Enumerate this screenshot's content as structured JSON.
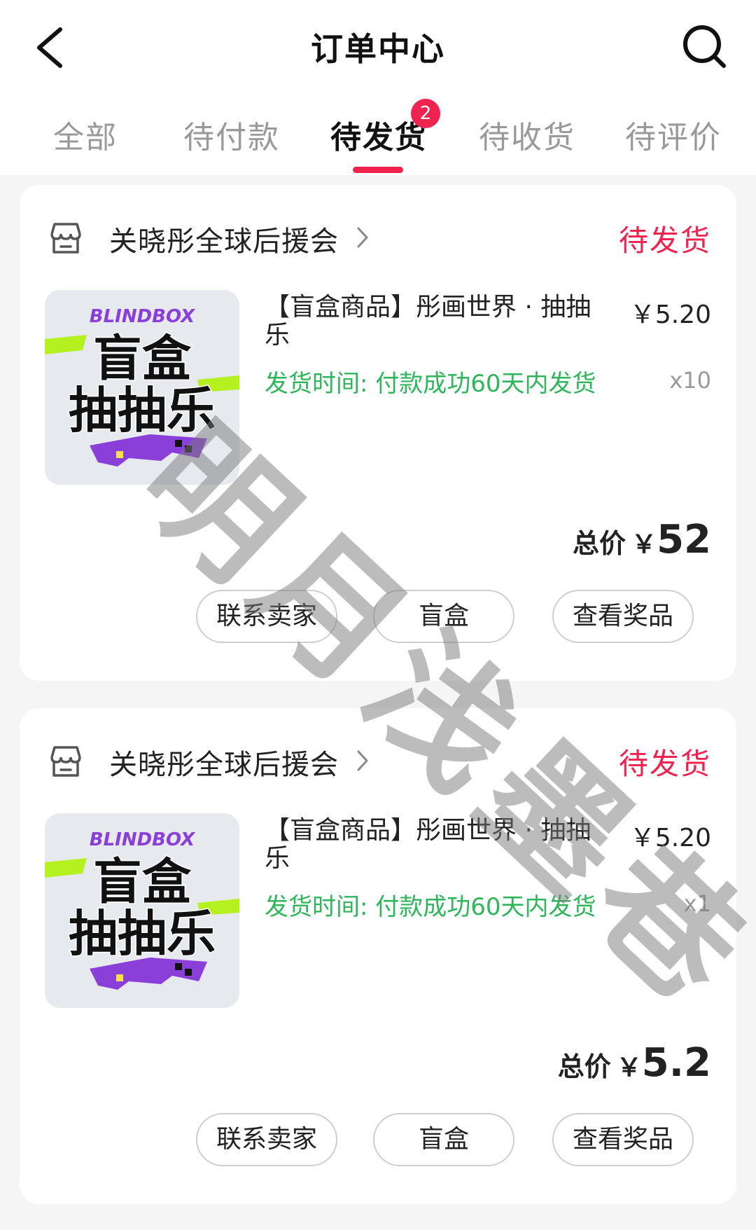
{
  "header": {
    "title": "订单中心"
  },
  "tabs": [
    {
      "label": "全部"
    },
    {
      "label": "待付款"
    },
    {
      "label": "待发货",
      "badge": "2"
    },
    {
      "label": "待收货"
    },
    {
      "label": "待评价"
    }
  ],
  "orders": [
    {
      "shop": "关晓彤全球后援会",
      "status": "待发货",
      "thumb": {
        "brand": "BLINDBOX",
        "line1": "盲盒",
        "line2": "抽抽乐"
      },
      "product_title": "【盲盒商品】彤画世界 · 抽抽乐",
      "price": "￥5.20",
      "ship_time": "发货时间: 付款成功60天内发货",
      "qty": "x10",
      "total_label": "总价",
      "total_currency": "￥",
      "total_value": "52",
      "buttons": {
        "contact": "联系卖家",
        "blindbox": "盲盒",
        "prize": "查看奖品"
      }
    },
    {
      "shop": "关晓彤全球后援会",
      "status": "待发货",
      "thumb": {
        "brand": "BLINDBOX",
        "line1": "盲盒",
        "line2": "抽抽乐"
      },
      "product_title": "【盲盒商品】彤画世界 · 抽抽乐",
      "price": "￥5.20",
      "ship_time": "发货时间: 付款成功60天内发货",
      "qty": "x1",
      "total_label": "总价",
      "total_currency": "￥",
      "total_value": "5.2",
      "buttons": {
        "contact": "联系卖家",
        "blindbox": "盲盒",
        "prize": "查看奖品"
      }
    }
  ],
  "watermark": "明月浅墨巷",
  "colors": {
    "accent": "#f0224e",
    "ship_green": "#2fb65a",
    "muted": "#999999",
    "thumb_purple": "#8b3fd9",
    "thumb_green": "#b5f01f"
  },
  "icons": {
    "back": "back-arrow-icon",
    "search": "search-icon",
    "shop": "shop-icon",
    "chevron": "chevron-right-icon"
  }
}
